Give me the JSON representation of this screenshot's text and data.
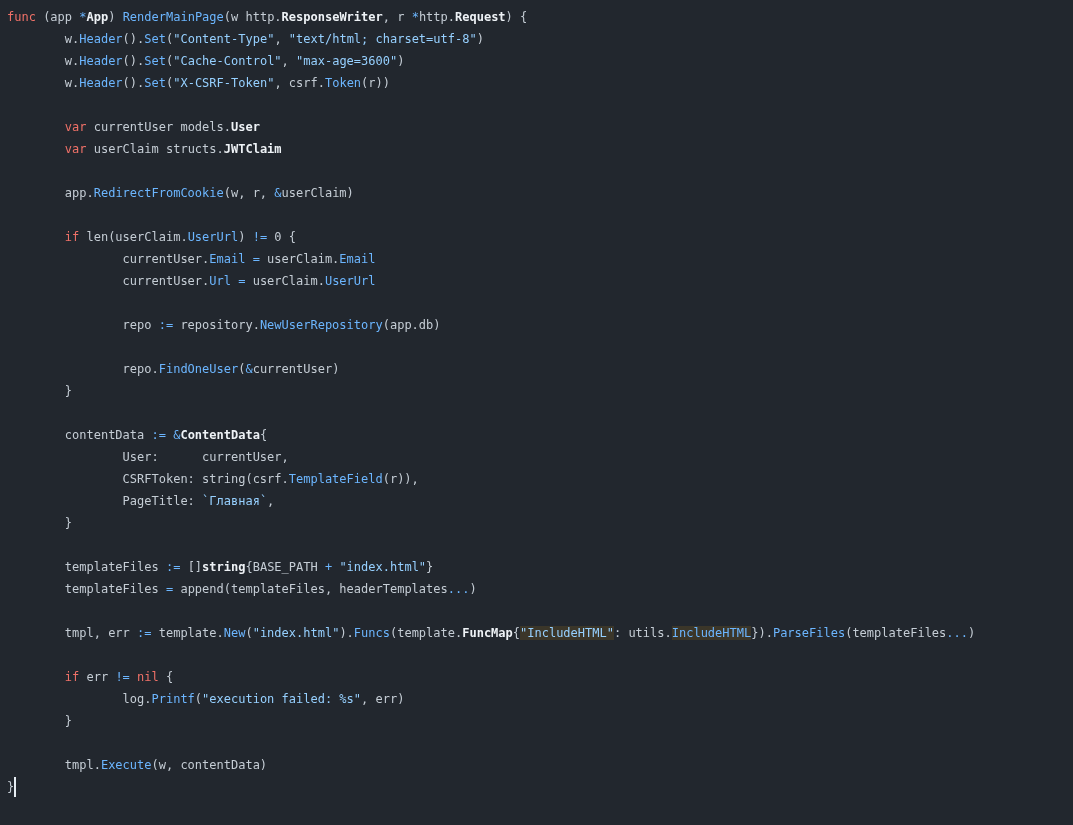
{
  "editor": {
    "lines": [
      {
        "kind": "code",
        "cursor": false,
        "tokens": [
          {
            "kind": "k",
            "text": "func"
          },
          {
            "kind": "p",
            "text": " (app "
          },
          {
            "kind": "o",
            "text": "*"
          },
          {
            "kind": "t",
            "text": "App"
          },
          {
            "kind": "p",
            "text": ") "
          },
          {
            "kind": "f",
            "text": "RenderMainPage"
          },
          {
            "kind": "p",
            "text": "(w http."
          },
          {
            "kind": "t",
            "text": "ResponseWriter"
          },
          {
            "kind": "p",
            "text": ", r "
          },
          {
            "kind": "o",
            "text": "*"
          },
          {
            "kind": "p",
            "text": "http."
          },
          {
            "kind": "t",
            "text": "Request"
          },
          {
            "kind": "p",
            "text": ") {"
          }
        ]
      },
      {
        "kind": "code",
        "cursor": false,
        "tokens": [
          {
            "kind": "p",
            "text": "\tw."
          },
          {
            "kind": "f",
            "text": "Header"
          },
          {
            "kind": "p",
            "text": "()."
          },
          {
            "kind": "f",
            "text": "Set"
          },
          {
            "kind": "p",
            "text": "("
          },
          {
            "kind": "s",
            "text": "\"Content-Type\""
          },
          {
            "kind": "p",
            "text": ", "
          },
          {
            "kind": "s",
            "text": "\"text/html; charset=utf-8\""
          },
          {
            "kind": "p",
            "text": ")"
          }
        ]
      },
      {
        "kind": "code",
        "cursor": false,
        "tokens": [
          {
            "kind": "p",
            "text": "\tw."
          },
          {
            "kind": "f",
            "text": "Header"
          },
          {
            "kind": "p",
            "text": "()."
          },
          {
            "kind": "f",
            "text": "Set"
          },
          {
            "kind": "p",
            "text": "("
          },
          {
            "kind": "s",
            "text": "\"Cache-Control\""
          },
          {
            "kind": "p",
            "text": ", "
          },
          {
            "kind": "s",
            "text": "\"max-age=3600\""
          },
          {
            "kind": "p",
            "text": ")"
          }
        ]
      },
      {
        "kind": "code",
        "cursor": false,
        "tokens": [
          {
            "kind": "p",
            "text": "\tw."
          },
          {
            "kind": "f",
            "text": "Header"
          },
          {
            "kind": "p",
            "text": "()."
          },
          {
            "kind": "f",
            "text": "Set"
          },
          {
            "kind": "p",
            "text": "("
          },
          {
            "kind": "s",
            "text": "\"X-CSRF-Token\""
          },
          {
            "kind": "p",
            "text": ", csrf."
          },
          {
            "kind": "f",
            "text": "Token"
          },
          {
            "kind": "p",
            "text": "(r))"
          }
        ]
      },
      {
        "kind": "blank"
      },
      {
        "kind": "code",
        "cursor": false,
        "tokens": [
          {
            "kind": "k",
            "text": "\tvar"
          },
          {
            "kind": "p",
            "text": " currentUser models."
          },
          {
            "kind": "t",
            "text": "User"
          }
        ]
      },
      {
        "kind": "code",
        "cursor": false,
        "tokens": [
          {
            "kind": "k",
            "text": "\tvar"
          },
          {
            "kind": "p",
            "text": " userClaim structs."
          },
          {
            "kind": "t",
            "text": "JWTClaim"
          }
        ]
      },
      {
        "kind": "blank"
      },
      {
        "kind": "code",
        "cursor": false,
        "tokens": [
          {
            "kind": "p",
            "text": "\tapp."
          },
          {
            "kind": "f",
            "text": "RedirectFromCookie"
          },
          {
            "kind": "p",
            "text": "(w, r, "
          },
          {
            "kind": "o",
            "text": "&"
          },
          {
            "kind": "p",
            "text": "userClaim)"
          }
        ]
      },
      {
        "kind": "blank"
      },
      {
        "kind": "code",
        "cursor": false,
        "tokens": [
          {
            "kind": "k",
            "text": "\tif"
          },
          {
            "kind": "p",
            "text": " len(userClaim."
          },
          {
            "kind": "f",
            "text": "UserUrl"
          },
          {
            "kind": "p",
            "text": ") "
          },
          {
            "kind": "o",
            "text": "!="
          },
          {
            "kind": "p",
            "text": " 0 {"
          }
        ]
      },
      {
        "kind": "code",
        "cursor": false,
        "tokens": [
          {
            "kind": "p",
            "text": "\t\tcurrentUser."
          },
          {
            "kind": "f",
            "text": "Email"
          },
          {
            "kind": "o",
            "text": " ="
          },
          {
            "kind": "p",
            "text": " userClaim."
          },
          {
            "kind": "f",
            "text": "Email"
          }
        ]
      },
      {
        "kind": "code",
        "cursor": false,
        "tokens": [
          {
            "kind": "p",
            "text": "\t\tcurrentUser."
          },
          {
            "kind": "f",
            "text": "Url"
          },
          {
            "kind": "o",
            "text": " ="
          },
          {
            "kind": "p",
            "text": " userClaim."
          },
          {
            "kind": "f",
            "text": "UserUrl"
          }
        ]
      },
      {
        "kind": "blank"
      },
      {
        "kind": "code",
        "cursor": false,
        "tokens": [
          {
            "kind": "p",
            "text": "\t\trepo "
          },
          {
            "kind": "o",
            "text": ":="
          },
          {
            "kind": "p",
            "text": " repository."
          },
          {
            "kind": "f",
            "text": "NewUserRepository"
          },
          {
            "kind": "p",
            "text": "(app.db)"
          }
        ]
      },
      {
        "kind": "blank"
      },
      {
        "kind": "code",
        "cursor": false,
        "tokens": [
          {
            "kind": "p",
            "text": "\t\trepo."
          },
          {
            "kind": "f",
            "text": "FindOneUser"
          },
          {
            "kind": "p",
            "text": "("
          },
          {
            "kind": "o",
            "text": "&"
          },
          {
            "kind": "p",
            "text": "currentUser)"
          }
        ]
      },
      {
        "kind": "code",
        "cursor": false,
        "tokens": [
          {
            "kind": "p",
            "text": "\t}"
          }
        ]
      },
      {
        "kind": "blank"
      },
      {
        "kind": "code",
        "cursor": false,
        "tokens": [
          {
            "kind": "p",
            "text": "\tcontentData "
          },
          {
            "kind": "o",
            "text": ":="
          },
          {
            "kind": "o",
            "text": " &"
          },
          {
            "kind": "t",
            "text": "ContentData"
          },
          {
            "kind": "p",
            "text": "{"
          }
        ]
      },
      {
        "kind": "code",
        "cursor": false,
        "tokens": [
          {
            "kind": "p",
            "text": "\t\tUser:      currentUser,"
          }
        ]
      },
      {
        "kind": "code",
        "cursor": false,
        "tokens": [
          {
            "kind": "p",
            "text": "\t\tCSRFToken: string(csrf."
          },
          {
            "kind": "f",
            "text": "TemplateField"
          },
          {
            "kind": "p",
            "text": "(r)),"
          }
        ]
      },
      {
        "kind": "code",
        "cursor": false,
        "tokens": [
          {
            "kind": "p",
            "text": "\t\tPageTitle: "
          },
          {
            "kind": "s",
            "text": "`Главная`"
          },
          {
            "kind": "p",
            "text": ","
          }
        ]
      },
      {
        "kind": "code",
        "cursor": false,
        "tokens": [
          {
            "kind": "p",
            "text": "\t}"
          }
        ]
      },
      {
        "kind": "blank"
      },
      {
        "kind": "code",
        "cursor": false,
        "tokens": [
          {
            "kind": "p",
            "text": "\ttemplateFiles "
          },
          {
            "kind": "o",
            "text": ":="
          },
          {
            "kind": "p",
            "text": " []"
          },
          {
            "kind": "t",
            "text": "string"
          },
          {
            "kind": "p",
            "text": "{BASE_PATH "
          },
          {
            "kind": "o",
            "text": "+"
          },
          {
            "kind": "s",
            "text": " \"index.html\""
          },
          {
            "kind": "p",
            "text": "}"
          }
        ]
      },
      {
        "kind": "code",
        "cursor": false,
        "tokens": [
          {
            "kind": "p",
            "text": "\ttemplateFiles "
          },
          {
            "kind": "o",
            "text": "="
          },
          {
            "kind": "p",
            "text": " append(templateFiles, headerTemplates"
          },
          {
            "kind": "o",
            "text": "..."
          },
          {
            "kind": "p",
            "text": ")"
          }
        ]
      },
      {
        "kind": "blank"
      },
      {
        "kind": "code",
        "cursor": false,
        "tokens": [
          {
            "kind": "p",
            "text": "\ttmpl, err "
          },
          {
            "kind": "o",
            "text": ":="
          },
          {
            "kind": "p",
            "text": " template."
          },
          {
            "kind": "f",
            "text": "New"
          },
          {
            "kind": "p",
            "text": "("
          },
          {
            "kind": "s",
            "text": "\"index.html\""
          },
          {
            "kind": "p",
            "text": ")."
          },
          {
            "kind": "f",
            "text": "Funcs"
          },
          {
            "kind": "p",
            "text": "(template."
          },
          {
            "kind": "t",
            "text": "FuncMap"
          },
          {
            "kind": "p",
            "text": "{"
          },
          {
            "kind": "smatch",
            "text": "\"IncludeHTML\""
          },
          {
            "kind": "p",
            "text": ": utils."
          },
          {
            "kind": "fmatch",
            "text": "IncludeHTML"
          },
          {
            "kind": "p",
            "text": "})."
          },
          {
            "kind": "f",
            "text": "ParseFiles"
          },
          {
            "kind": "p",
            "text": "(templateFiles"
          },
          {
            "kind": "o",
            "text": "..."
          },
          {
            "kind": "p",
            "text": ")"
          }
        ]
      },
      {
        "kind": "blank"
      },
      {
        "kind": "code",
        "cursor": false,
        "tokens": [
          {
            "kind": "k",
            "text": "\tif"
          },
          {
            "kind": "p",
            "text": " err "
          },
          {
            "kind": "o",
            "text": "!="
          },
          {
            "kind": "k",
            "text": " nil"
          },
          {
            "kind": "p",
            "text": " {"
          }
        ]
      },
      {
        "kind": "code",
        "cursor": false,
        "tokens": [
          {
            "kind": "p",
            "text": "\t\tlog."
          },
          {
            "kind": "f",
            "text": "Printf"
          },
          {
            "kind": "p",
            "text": "("
          },
          {
            "kind": "s",
            "text": "\"execution failed: %s\""
          },
          {
            "kind": "p",
            "text": ", err)"
          }
        ]
      },
      {
        "kind": "code",
        "cursor": false,
        "tokens": [
          {
            "kind": "p",
            "text": "\t}"
          }
        ]
      },
      {
        "kind": "blank"
      },
      {
        "kind": "code",
        "cursor": false,
        "tokens": [
          {
            "kind": "p",
            "text": "\ttmpl."
          },
          {
            "kind": "f",
            "text": "Execute"
          },
          {
            "kind": "p",
            "text": "(w, contentData)"
          }
        ]
      },
      {
        "kind": "code",
        "cursor": true,
        "tokens": [
          {
            "kind": "p",
            "text": "}"
          }
        ]
      }
    ]
  }
}
